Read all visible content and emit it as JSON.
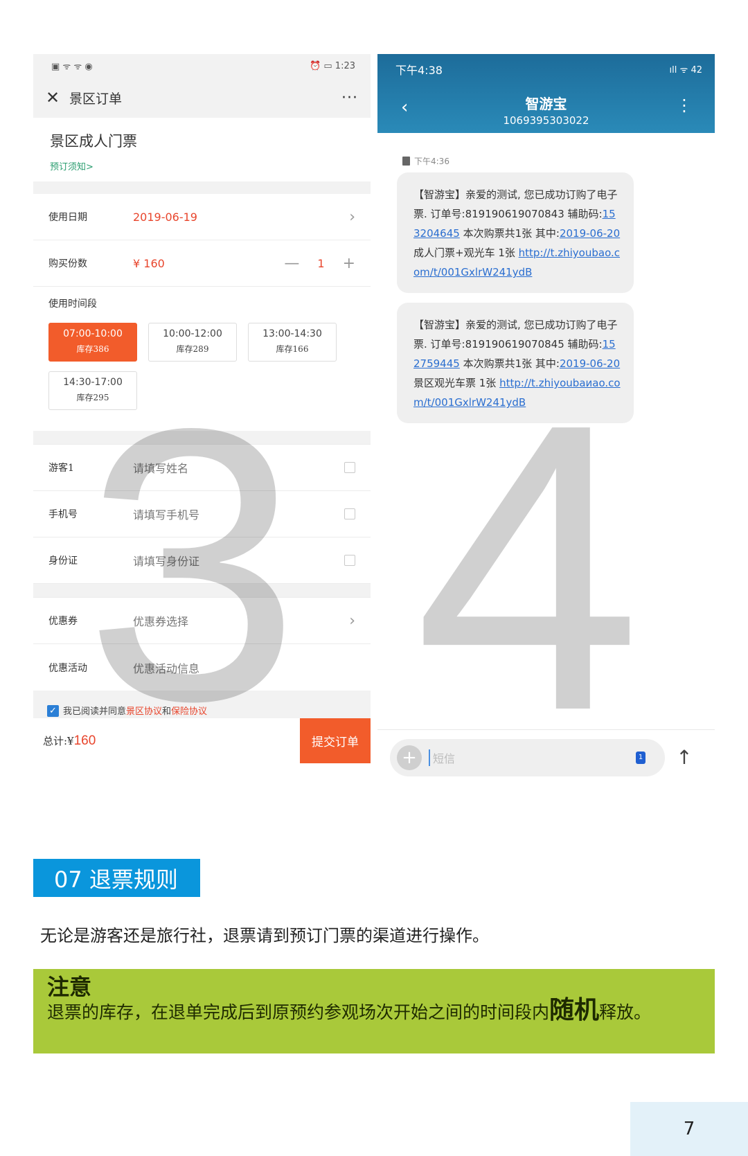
{
  "left_phone": {
    "status": {
      "left": "▣ ᯤ ᯤ ◉",
      "right": "⏰ ▭ 1:23"
    },
    "nav": {
      "close": "✕",
      "title": "景区订单",
      "more": "···"
    },
    "ticket": {
      "name": "景区成人门票",
      "notice": "预订须知>"
    },
    "date": {
      "label": "使用日期",
      "value": "2019-06-19"
    },
    "qty": {
      "label": "购买份数",
      "price": "¥ 160",
      "minus": "—",
      "count": "1",
      "plus": "+"
    },
    "slots": {
      "label": "使用时间段",
      "items": [
        {
          "time": "07:00-10:00",
          "stock": "库存386"
        },
        {
          "time": "10:00-12:00",
          "stock": "库存289"
        },
        {
          "time": "13:00-14:30",
          "stock": "库存166"
        },
        {
          "time": "14:30-17:00",
          "stock": "库存295"
        }
      ]
    },
    "visitor": {
      "label": "游客1",
      "placeholder": "请填写姓名"
    },
    "phone": {
      "label": "手机号",
      "placeholder": "请填写手机号"
    },
    "id": {
      "label": "身份证",
      "placeholder": "请填写身份证"
    },
    "coupon": {
      "label": "优惠券",
      "placeholder": "优惠券选择"
    },
    "promo": {
      "label": "优惠活动",
      "placeholder": "优惠活动信息"
    },
    "agree": {
      "prefix": "我已阅读并同意",
      "link1": "景区协议",
      "and": "和",
      "link2": "保险协议"
    },
    "footer": {
      "total_label": "总计:¥",
      "total": "160",
      "submit": "提交订单"
    }
  },
  "right_phone": {
    "status": {
      "time": "下午4:38",
      "icons": "ıll ᯤ 42"
    },
    "sender": {
      "name": "智游宝",
      "number": "1069395303022"
    },
    "message_time": "下午4:36",
    "messages": [
      {
        "text1": "【智游宝】亲爱的测试, 您已成功订购了电子票. 订单号:819190619070843 辅助码:",
        "code": "153204645",
        "text2": " 本次购票共1张 其中:",
        "date": "2019-06-20",
        "text3": " 成人门票+观光车 1张 ",
        "url": "http://t.zhiyoubao.com/t/001GxlrW241ydB"
      },
      {
        "text1": "【智游宝】亲爱的测试, 您已成功订购了电子票. 订单号:819190619070845 辅助码:",
        "code": "152759445",
        "text2": " 本次购票共1张 其中:",
        "date": "2019-06-20",
        "text3": " 景区观光车票 1张 ",
        "url": "http://t.zhiyoubaиao.com/t/001GxlrW241ydB"
      }
    ],
    "input": {
      "placeholder": "短信",
      "sim": "1",
      "send": "↑"
    }
  },
  "watermarks": {
    "left": "3",
    "right": "4"
  },
  "section": {
    "heading": "07 退票规则",
    "paragraph": "无论是游客还是旅行社，退票请到预订门票的渠道进行操作。",
    "note": {
      "title": "注意",
      "body_before": "退票的库存，在退单完成后到原预约参观场次开始之间的时间段内",
      "emphasis": "随机",
      "body_after": "释放。"
    }
  },
  "page_number": "7",
  "colors": {
    "accent_orange": "#f25c2b",
    "section_blue": "#0a96dc",
    "note_green": "#a9c93a"
  }
}
